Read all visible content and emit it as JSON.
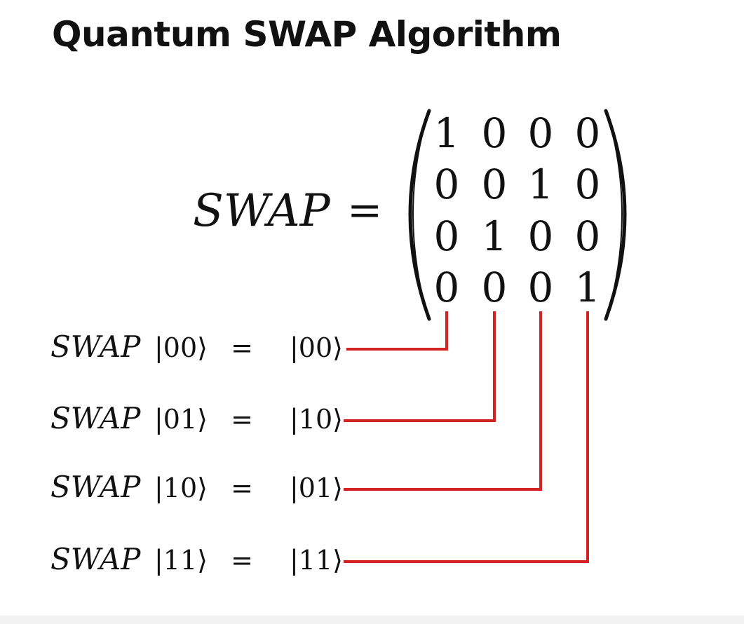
{
  "title": "Quantum SWAP Algorithm",
  "lhs": {
    "label": "SWAP",
    "equals": "="
  },
  "matrix": [
    [
      "1",
      "0",
      "0",
      "0"
    ],
    [
      "0",
      "0",
      "1",
      "0"
    ],
    [
      "0",
      "1",
      "0",
      "0"
    ],
    [
      "0",
      "0",
      "0",
      "1"
    ]
  ],
  "equations": [
    {
      "op": "SWAP",
      "input": "00",
      "equals": "=",
      "output": "00"
    },
    {
      "op": "SWAP",
      "input": "01",
      "equals": "=",
      "output": "10"
    },
    {
      "op": "SWAP",
      "input": "10",
      "equals": "=",
      "output": "01"
    },
    {
      "op": "SWAP",
      "input": "11",
      "equals": "=",
      "output": "11"
    }
  ],
  "colors": {
    "text": "#111111",
    "connector": "#d42323",
    "background": "#ffffff"
  }
}
